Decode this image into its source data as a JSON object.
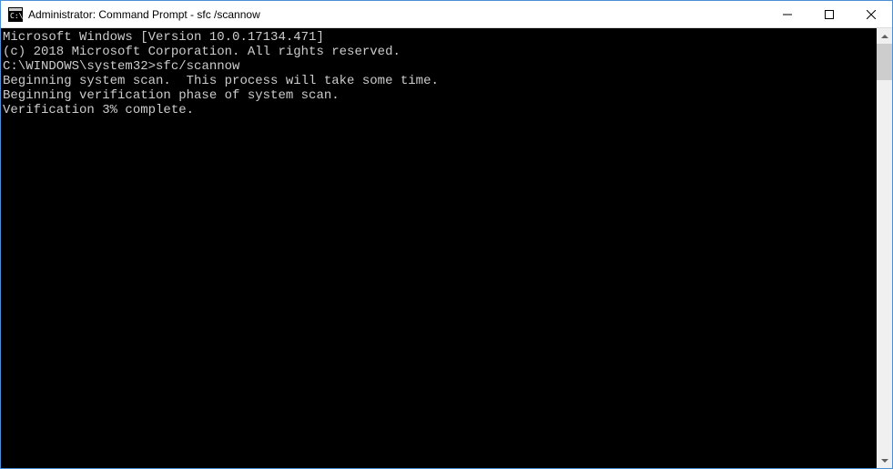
{
  "titlebar": {
    "title": "Administrator: Command Prompt - sfc /scannow"
  },
  "console": {
    "line1": "Microsoft Windows [Version 10.0.17134.471]",
    "line2": "(c) 2018 Microsoft Corporation. All rights reserved.",
    "blank1": "",
    "prompt_path": "C:\\WINDOWS\\system32>",
    "prompt_command": "sfc/scannow",
    "blank2": "",
    "line3": "Beginning system scan.  This process will take some time.",
    "blank3": "",
    "line4": "Beginning verification phase of system scan.",
    "line5": "Verification 3% complete."
  }
}
